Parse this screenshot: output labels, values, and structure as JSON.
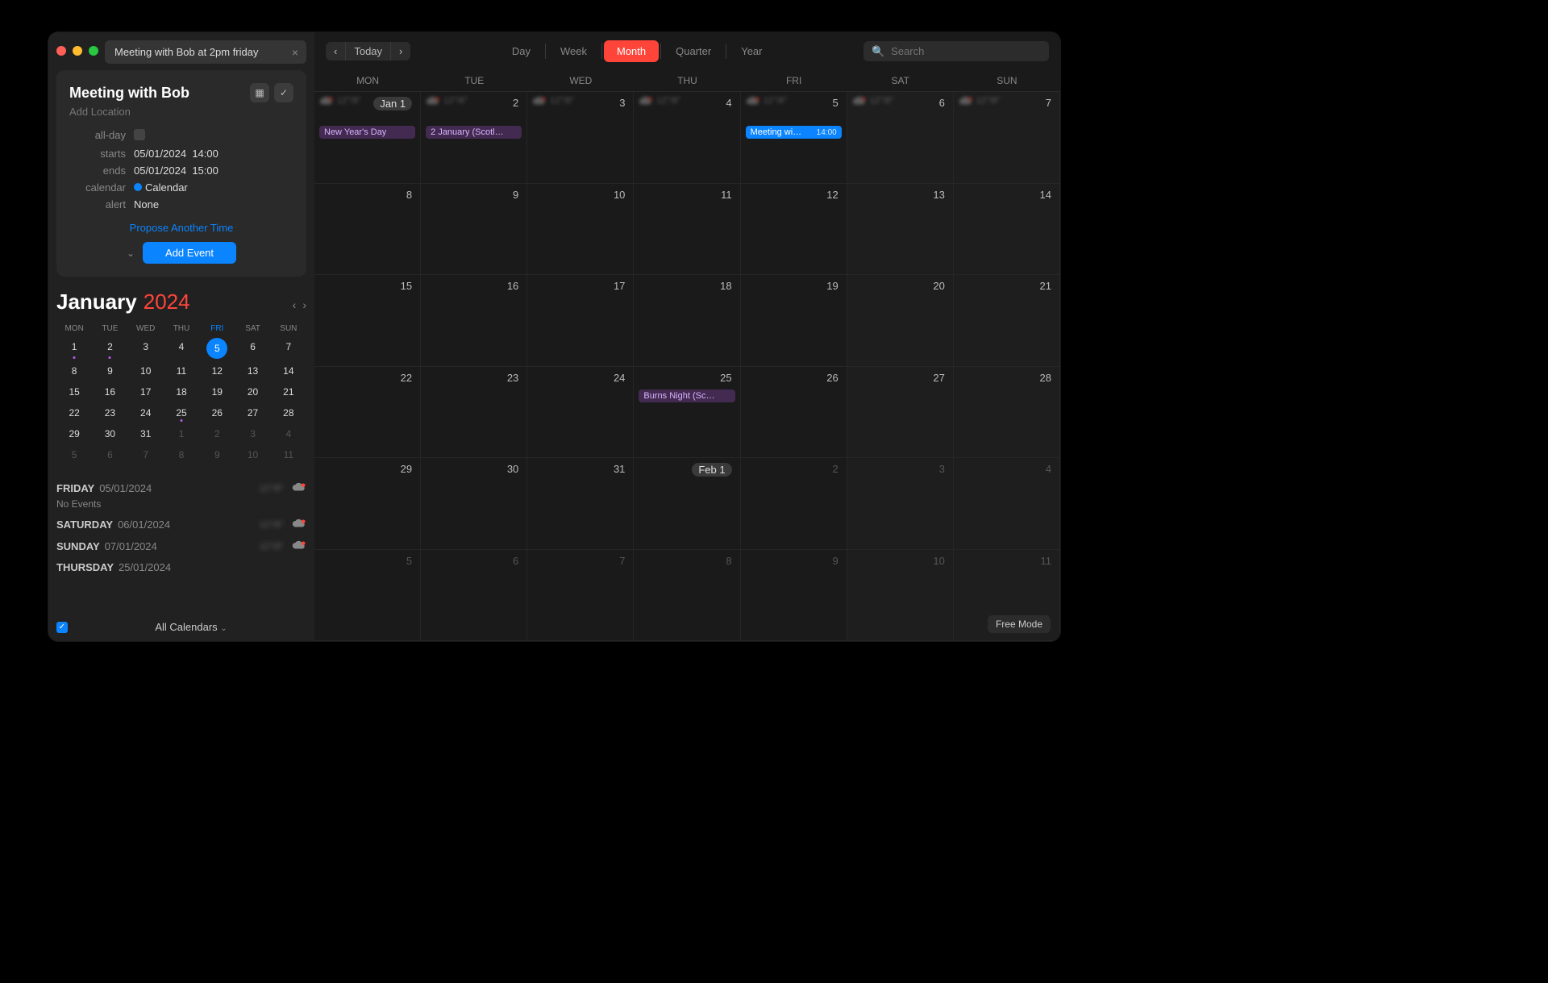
{
  "traffic_colors": [
    "#ff5f57",
    "#febc2e",
    "#28c840"
  ],
  "nl_input": "Meeting with Bob at 2pm friday",
  "event_card": {
    "title": "Meeting with Bob",
    "location_placeholder": "Add Location",
    "allday_label": "all-day",
    "starts_label": "starts",
    "starts_date": "05/01/2024",
    "starts_time": "14:00",
    "ends_label": "ends",
    "ends_date": "05/01/2024",
    "ends_time": "15:00",
    "calendar_label": "calendar",
    "calendar_name": "Calendar",
    "alert_label": "alert",
    "alert_value": "None",
    "propose": "Propose Another Time",
    "add_button": "Add Event"
  },
  "mini": {
    "month": "January",
    "year": "2024",
    "dow": [
      "MON",
      "TUE",
      "WED",
      "THU",
      "FRI",
      "SAT",
      "SUN"
    ],
    "today_col": 4,
    "days": [
      {
        "n": "1",
        "dot": "#bf5af2"
      },
      {
        "n": "2",
        "dot": "#bf5af2"
      },
      {
        "n": "3"
      },
      {
        "n": "4"
      },
      {
        "n": "5",
        "sel": true
      },
      {
        "n": "6"
      },
      {
        "n": "7"
      },
      {
        "n": "8"
      },
      {
        "n": "9"
      },
      {
        "n": "10"
      },
      {
        "n": "11"
      },
      {
        "n": "12"
      },
      {
        "n": "13"
      },
      {
        "n": "14"
      },
      {
        "n": "15"
      },
      {
        "n": "16"
      },
      {
        "n": "17"
      },
      {
        "n": "18"
      },
      {
        "n": "19"
      },
      {
        "n": "20"
      },
      {
        "n": "21"
      },
      {
        "n": "22"
      },
      {
        "n": "23"
      },
      {
        "n": "24"
      },
      {
        "n": "25",
        "dot": "#bf5af2"
      },
      {
        "n": "26"
      },
      {
        "n": "27"
      },
      {
        "n": "28"
      },
      {
        "n": "29"
      },
      {
        "n": "30"
      },
      {
        "n": "31"
      },
      {
        "n": "1",
        "dim": true
      },
      {
        "n": "2",
        "dim": true
      },
      {
        "n": "3",
        "dim": true
      },
      {
        "n": "4",
        "dim": true
      },
      {
        "n": "5",
        "dim": true
      },
      {
        "n": "6",
        "dim": true
      },
      {
        "n": "7",
        "dim": true
      },
      {
        "n": "8",
        "dim": true
      },
      {
        "n": "9",
        "dim": true
      },
      {
        "n": "10",
        "dim": true
      },
      {
        "n": "11",
        "dim": true
      }
    ]
  },
  "agenda": [
    {
      "day": "FRIDAY",
      "date": "05/01/2024",
      "sub": "No Events",
      "wx": true
    },
    {
      "day": "SATURDAY",
      "date": "06/01/2024",
      "wx": true
    },
    {
      "day": "SUNDAY",
      "date": "07/01/2024",
      "wx": true
    },
    {
      "day": "THURSDAY",
      "date": "25/01/2024"
    }
  ],
  "all_calendars": "All Calendars",
  "toolbar": {
    "today": "Today",
    "views": [
      "Day",
      "Week",
      "Month",
      "Quarter",
      "Year"
    ],
    "active_view": 2,
    "search_placeholder": "Search"
  },
  "dow_header": [
    "MON",
    "TUE",
    "WED",
    "THU",
    "FRI",
    "SAT",
    "SUN"
  ],
  "grid": [
    [
      {
        "n": "Jan 1",
        "pill": true,
        "wx": true,
        "events": [
          {
            "t": "New Year's Day",
            "cls": "ev-purple"
          }
        ]
      },
      {
        "n": "2",
        "wx": true,
        "events": [
          {
            "t": "2 January (Scotl…",
            "cls": "ev-purple"
          }
        ]
      },
      {
        "n": "3",
        "wx": true
      },
      {
        "n": "4",
        "wx": true
      },
      {
        "n": "5",
        "wx": true,
        "events": [
          {
            "t": "Meeting wi…",
            "time": "14:00",
            "cls": "ev-blue"
          }
        ]
      },
      {
        "n": "6",
        "wx": true
      },
      {
        "n": "7",
        "wx": true
      }
    ],
    [
      {
        "n": "8"
      },
      {
        "n": "9"
      },
      {
        "n": "10"
      },
      {
        "n": "11"
      },
      {
        "n": "12"
      },
      {
        "n": "13"
      },
      {
        "n": "14"
      }
    ],
    [
      {
        "n": "15"
      },
      {
        "n": "16"
      },
      {
        "n": "17"
      },
      {
        "n": "18"
      },
      {
        "n": "19"
      },
      {
        "n": "20"
      },
      {
        "n": "21"
      }
    ],
    [
      {
        "n": "22"
      },
      {
        "n": "23"
      },
      {
        "n": "24"
      },
      {
        "n": "25",
        "events": [
          {
            "t": "Burns Night (Sc…",
            "cls": "ev-purple"
          }
        ]
      },
      {
        "n": "26"
      },
      {
        "n": "27"
      },
      {
        "n": "28"
      }
    ],
    [
      {
        "n": "29"
      },
      {
        "n": "30"
      },
      {
        "n": "31"
      },
      {
        "n": "Feb 1",
        "pill": true
      },
      {
        "n": "2",
        "dim": true
      },
      {
        "n": "3",
        "dim": true
      },
      {
        "n": "4",
        "dim": true
      }
    ],
    [
      {
        "n": "5",
        "dim": true
      },
      {
        "n": "6",
        "dim": true
      },
      {
        "n": "7",
        "dim": true
      },
      {
        "n": "8",
        "dim": true
      },
      {
        "n": "9",
        "dim": true
      },
      {
        "n": "10",
        "dim": true
      },
      {
        "n": "11",
        "dim": true
      }
    ]
  ],
  "free_mode": "Free Mode"
}
